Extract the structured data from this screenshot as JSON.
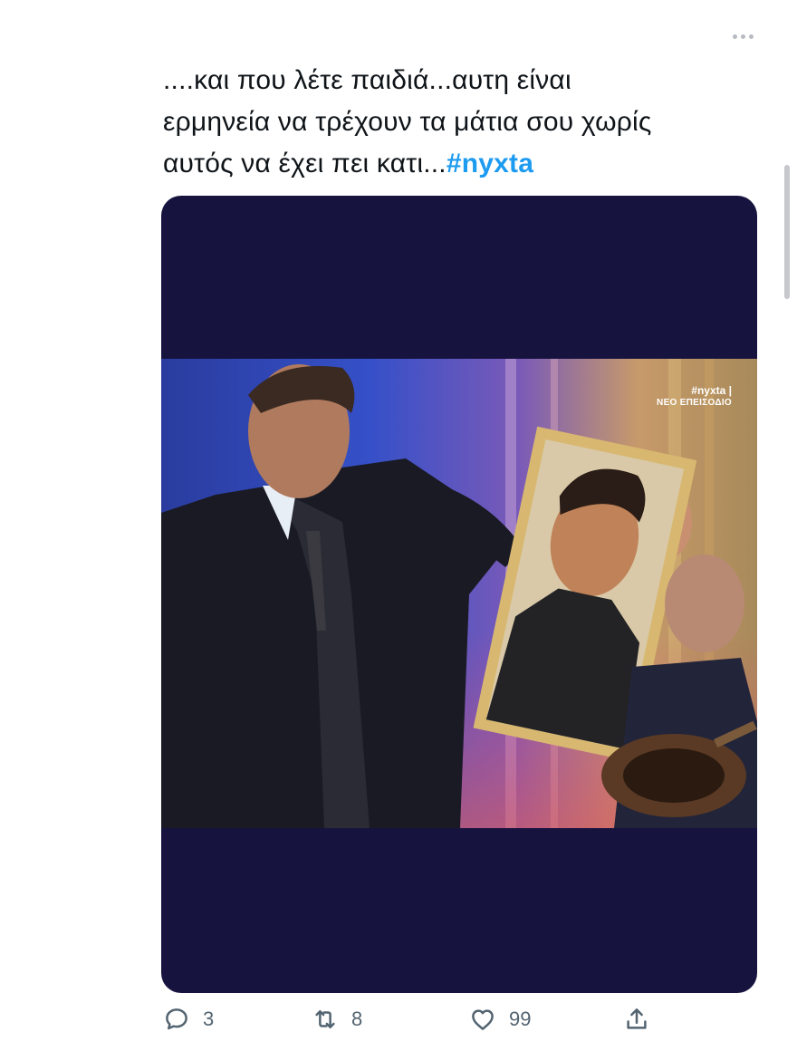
{
  "tweet": {
    "text_lines": [
      "....και που λέτε παιδιά...αυτη είναι",
      "ερμηνεία να τρέχουν τα μάτια σου χωρίς",
      "αυτός να έχει πει κατι..."
    ],
    "hashtag": "#nyxta"
  },
  "media": {
    "watermark_tag": "#nyxta |",
    "watermark_sub": "ΝΕΟ ΕΠΕΙΣΟΔΙΟ"
  },
  "actions": {
    "reply_count": "3",
    "retweet_count": "8",
    "like_count": "99"
  },
  "icons": {
    "more": "more-horizontal-icon",
    "reply": "reply-icon",
    "retweet": "retweet-icon",
    "like": "heart-icon",
    "share": "share-icon"
  },
  "colors": {
    "hashtag": "#1d9bf0",
    "media_bg": "#16133f",
    "action_gray": "#536471"
  }
}
